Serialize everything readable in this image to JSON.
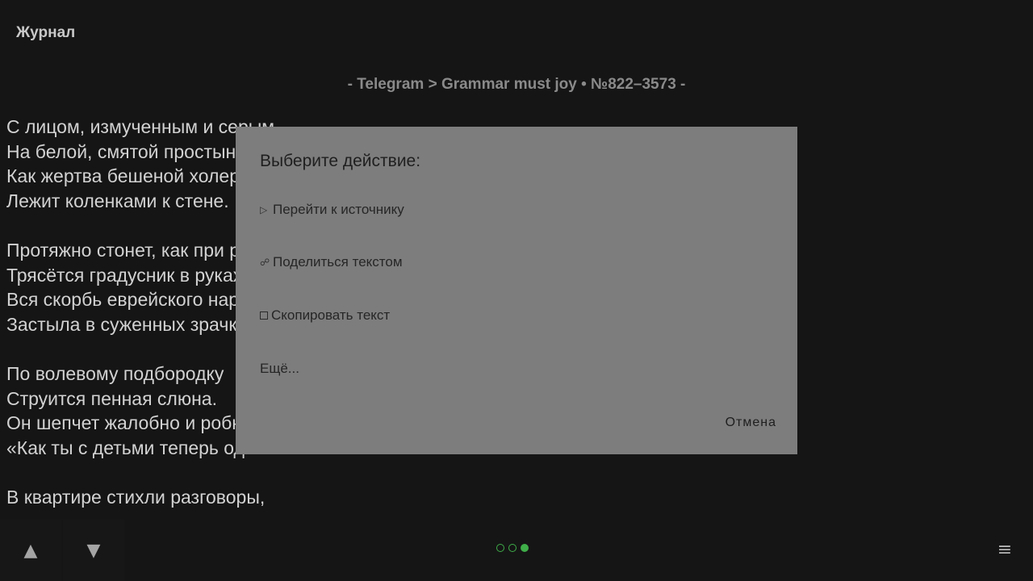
{
  "app": {
    "title": "Журнал"
  },
  "source": {
    "text": "- Telegram > Grammar must joy • №822–3573 -"
  },
  "poem": {
    "stanzas": [
      [
        "С лицом, измученным и серым,",
        "На белой, смятой простыне,",
        "Как жертва бешеной холеры,",
        "Лежит коленками к стене."
      ],
      [
        "Протяжно стонет, как при родах.",
        "Трясётся градусник в руках.",
        "Вся скорбь еврейского народа",
        "Застыла в суженных зрачках."
      ],
      [
        "По волевому подбородку",
        "Струится пенная слюна.",
        "Он шепчет жалобно и робко:",
        "«Как ты с детьми теперь одна?»"
      ],
      [
        "В квартире стихли разговоры,"
      ]
    ]
  },
  "dialog": {
    "title": "Выберите действие:",
    "items": [
      {
        "icon": "play-triangle-icon",
        "glyph": "▷",
        "label": "Перейти к источнику"
      },
      {
        "icon": "share-icon",
        "glyph": "☍",
        "label": "Поделиться текстом"
      },
      {
        "icon": "copy-icon",
        "glyph": "",
        "label": "Скопировать текст"
      },
      {
        "icon": "",
        "glyph": "",
        "label": "Ещё..."
      }
    ],
    "cancel_label": "Отмена"
  },
  "bottom_bar": {
    "up_glyph": "▲",
    "down_glyph": "▼",
    "page_dots": {
      "total": 3,
      "active": 3
    },
    "menu_glyph": "≡"
  },
  "colors": {
    "background": "#151515",
    "dialog": "#7d7d7d",
    "accent": "#3fae49"
  }
}
